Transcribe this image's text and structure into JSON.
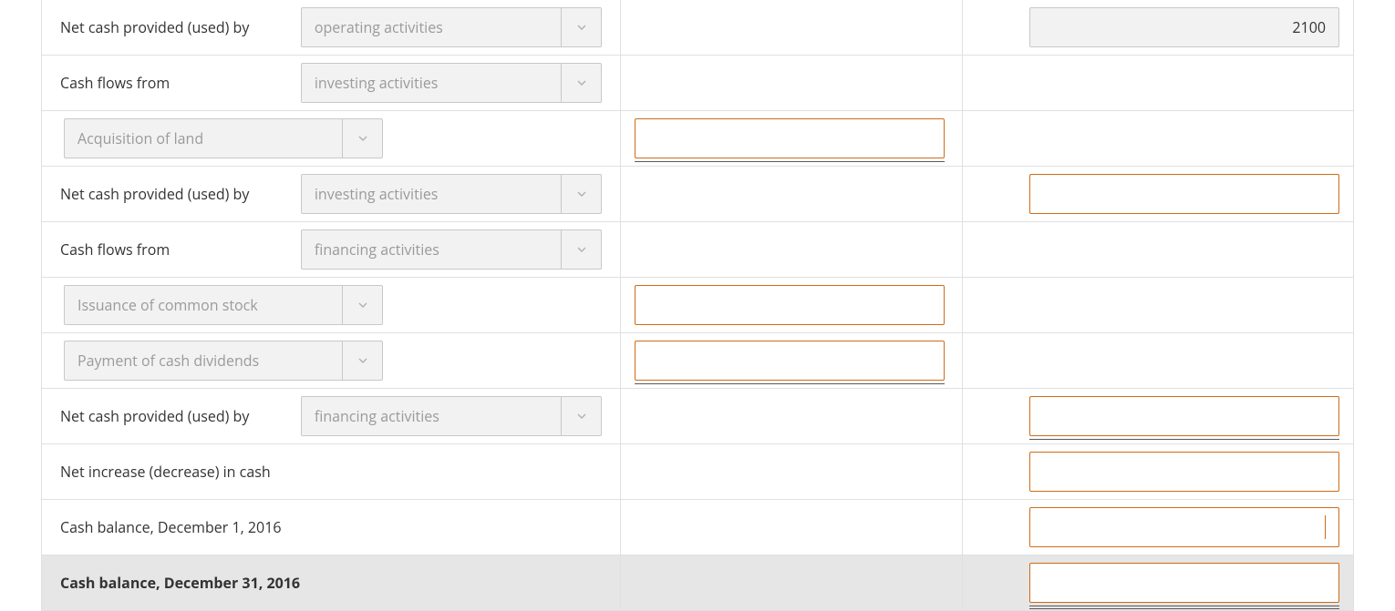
{
  "labels": {
    "net_cash_provided_used_by": "Net cash provided (used) by",
    "cash_flows_from": "Cash flows from",
    "net_increase_decrease": "Net increase (decrease) in cash",
    "cash_balance_begin": "Cash balance, December 1, 2016",
    "cash_balance_end": "Cash balance, December 31, 2016"
  },
  "dropdowns": {
    "operating_activities": "operating activities",
    "investing_activities": "investing activities",
    "financing_activities": "financing activities",
    "acquisition_of_land": "Acquisition of land",
    "issuance_of_common_stock": "Issuance of common stock",
    "payment_of_cash_dividends": "Payment of cash dividends"
  },
  "values": {
    "net_cash_operating": "2100"
  }
}
